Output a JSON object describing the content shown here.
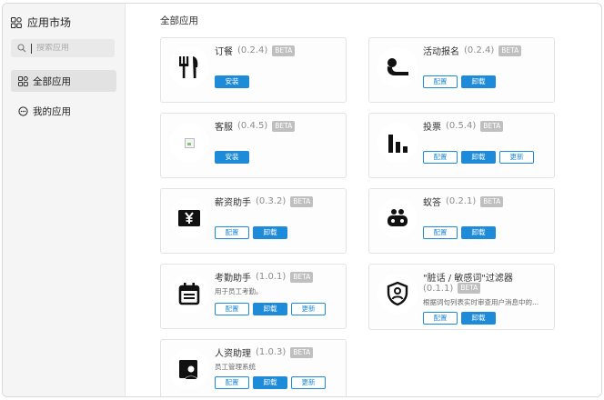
{
  "sidebar": {
    "brand": "应用市场",
    "search_placeholder": "搜索应用",
    "items": [
      {
        "label": "全部应用",
        "icon": "grid-icon",
        "active": true
      },
      {
        "label": "我的应用",
        "icon": "chat-icon",
        "active": false
      }
    ]
  },
  "main": {
    "title": "全部应用",
    "apps": [
      {
        "name": "订餐",
        "version": "(0.2.4)",
        "beta": "BETA",
        "desc": "",
        "buttons": [
          "安装"
        ],
        "icon": "fork-knife-icon"
      },
      {
        "name": "活动报名",
        "version": "(0.2.4)",
        "beta": "BETA",
        "desc": "",
        "buttons": [
          "配置",
          "卸载"
        ],
        "icon": "person-icon"
      },
      {
        "name": "客服",
        "version": "(0.4.5)",
        "beta": "BETA",
        "desc": "",
        "buttons": [
          "安装"
        ],
        "icon": "broken-image-icon"
      },
      {
        "name": "投票",
        "version": "(0.5.4)",
        "beta": "BETA",
        "desc": "",
        "buttons": [
          "配置",
          "卸载",
          "更新"
        ],
        "icon": "bar-chart-icon"
      },
      {
        "name": "薪资助手",
        "version": "(0.3.2)",
        "beta": "BETA",
        "desc": "",
        "buttons": [
          "配置",
          "卸载"
        ],
        "icon": "yen-icon"
      },
      {
        "name": "蚁答",
        "version": "(0.2.1)",
        "beta": "BETA",
        "desc": "",
        "buttons": [
          "配置",
          "卸载"
        ],
        "icon": "ant-icon"
      },
      {
        "name": "考勤助手",
        "version": "(1.0.1)",
        "beta": "BETA",
        "desc": "用于员工考勤。",
        "buttons": [
          "配置",
          "卸载",
          "更新"
        ],
        "icon": "calendar-icon"
      },
      {
        "name": "\"脏话 / 敏感词\"过滤器",
        "version": "(0.1.1)",
        "beta": "BETA",
        "desc": "根据词句列表实时审查用户消息中的...",
        "buttons": [
          "配置",
          "卸载"
        ],
        "icon": "shield-face-icon"
      },
      {
        "name": "人资助理",
        "version": "(1.0.3)",
        "beta": "BETA",
        "desc": "员工管理系统",
        "buttons": [
          "配置",
          "卸载",
          "更新"
        ],
        "icon": "employee-badge-icon"
      }
    ]
  },
  "colors": {
    "accent": "#1e8bd8",
    "beta_badge": "#bfbfbf",
    "sidebar_bg": "#f5f5f5"
  }
}
